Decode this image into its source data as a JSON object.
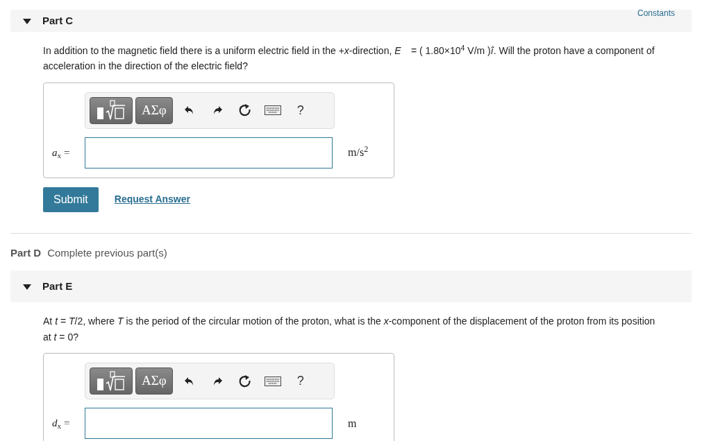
{
  "header_link": "Constants",
  "parts": [
    {
      "kind": "question",
      "title": "Part C",
      "expanded": true,
      "prompt": "In addition to the magnetic field there is a uniform electric field in the +*x*-direction, *E⃗* = ( 1.80×10$^{4}$ V/m )*î*. Will the proton have a component of acceleration in the direction of the electric field?",
      "toolbar": {
        "symbols": "ΑΣφ",
        "help": "?"
      },
      "answer_label": "*a*$_{x}$ =",
      "unit": "m/s$^{2}$",
      "buttons": {
        "submit": "Submit",
        "request": "Request Answer"
      }
    },
    {
      "kind": "locked",
      "title": "Part D",
      "status": "Complete previous part(s)"
    },
    {
      "kind": "question",
      "title": "Part E",
      "expanded": true,
      "prompt": "At *t* = *T*/2, where *T* is the period of the circular motion of the proton, what is the *x*-component of the displacement of the proton from its position at *t* = 0?",
      "toolbar": {
        "symbols": "ΑΣφ",
        "help": "?"
      },
      "answer_label": "*d*$_{x}$ =",
      "unit": "m"
    }
  ]
}
